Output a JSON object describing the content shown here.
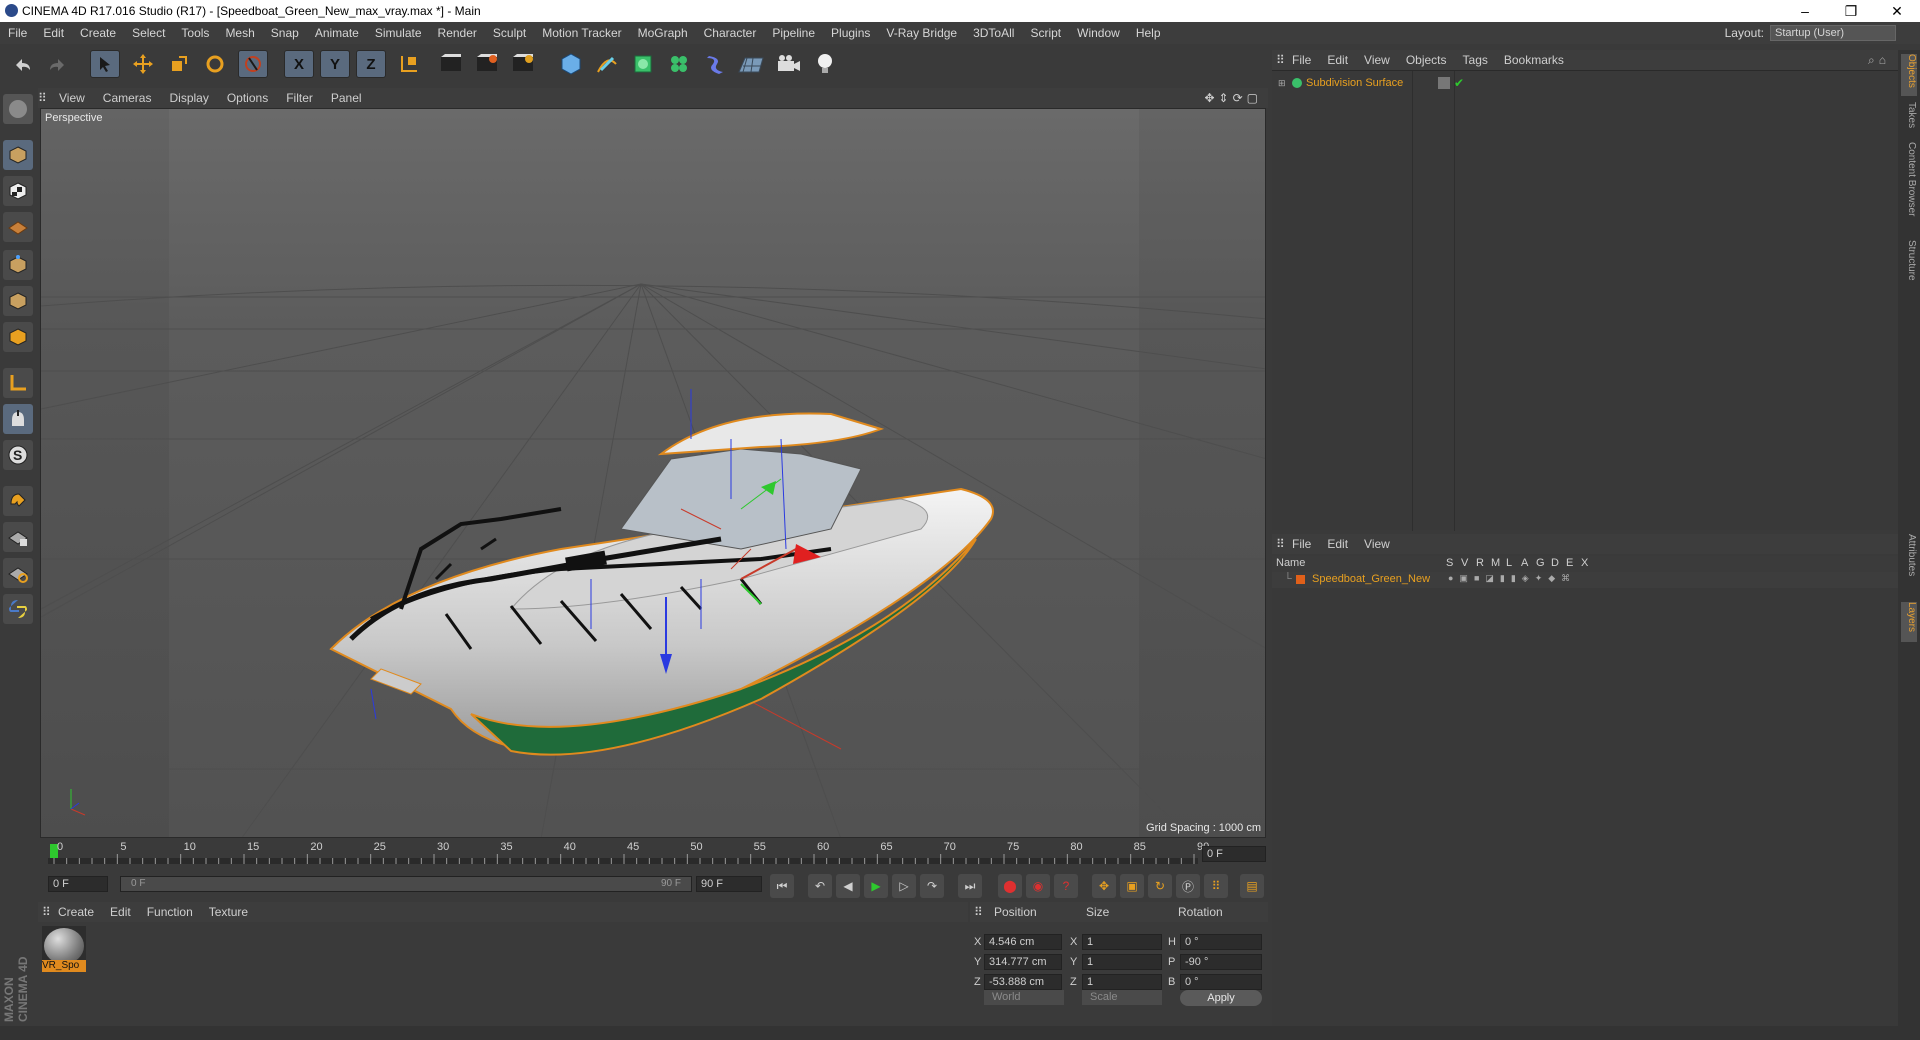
{
  "titlebar": {
    "title": "CINEMA 4D R17.016 Studio (R17) - [Speedboat_Green_New_max_vray.max *] - Main",
    "minimize": "–",
    "restore": "❐",
    "close": "✕"
  },
  "menubar": {
    "items": [
      "File",
      "Edit",
      "Create",
      "Select",
      "Tools",
      "Mesh",
      "Snap",
      "Animate",
      "Simulate",
      "Render",
      "Sculpt",
      "Motion Tracker",
      "MoGraph",
      "Character",
      "Pipeline",
      "Plugins",
      "V-Ray Bridge",
      "3DToAll",
      "Script",
      "Window",
      "Help"
    ],
    "layout_label": "Layout:",
    "layout_value": "Startup (User)"
  },
  "toolbar": {
    "axis_x": "X",
    "axis_y": "Y",
    "axis_z": "Z"
  },
  "viewport": {
    "menu": [
      "View",
      "Cameras",
      "Display",
      "Options",
      "Filter",
      "Panel"
    ],
    "label": "Perspective",
    "grid_spacing": "Grid Spacing : 1000 cm"
  },
  "timeline": {
    "ticks": [
      "0",
      "5",
      "10",
      "15",
      "20",
      "25",
      "30",
      "35",
      "40",
      "45",
      "50",
      "55",
      "60",
      "65",
      "70",
      "75",
      "80",
      "85",
      "90"
    ],
    "current_frame": "0 F",
    "start_field": "0 F",
    "range_start": "0 F",
    "range_end": "90 F",
    "end_field": "90 F"
  },
  "material_manager": {
    "menu": [
      "Create",
      "Edit",
      "Function",
      "Texture"
    ],
    "material_name": "VR_Spo"
  },
  "coordinates": {
    "headers": {
      "position": "Position",
      "size": "Size",
      "rotation": "Rotation"
    },
    "rows": [
      {
        "axis": "X",
        "pos": "4.546 cm",
        "size_axis": "X",
        "size": "1",
        "rot_axis": "H",
        "rot": "0 °"
      },
      {
        "axis": "Y",
        "pos": "314.777 cm",
        "size_axis": "Y",
        "size": "1",
        "rot_axis": "P",
        "rot": "-90 °"
      },
      {
        "axis": "Z",
        "pos": "-53.888 cm",
        "size_axis": "Z",
        "size": "1",
        "rot_axis": "B",
        "rot": "0 °"
      }
    ],
    "world": "World",
    "scale": "Scale",
    "apply": "Apply"
  },
  "objects_panel": {
    "menu": [
      "File",
      "Edit",
      "View",
      "Objects",
      "Tags",
      "Bookmarks"
    ],
    "object_name": "Subdivision Surface"
  },
  "layers_panel": {
    "menu": [
      "File",
      "Edit",
      "View"
    ],
    "columns": [
      "Name",
      "S",
      "V",
      "R",
      "M",
      "L",
      "A",
      "G",
      "D",
      "E",
      "X"
    ],
    "layer_name": "Speedboat_Green_New",
    "layer_color": "#e0601a"
  },
  "side_tabs": [
    "Objects",
    "Takes",
    "Content Browser",
    "Structure",
    "Attributes",
    "Layers"
  ],
  "maxon_logo": "MAXON CINEMA 4D",
  "colors": {
    "accent_orange": "#e08a1e",
    "hull_green": "#1f6b3a",
    "axis_red": "#d23a2a",
    "axis_green": "#2ec82e",
    "axis_blue": "#2a3ae0"
  }
}
